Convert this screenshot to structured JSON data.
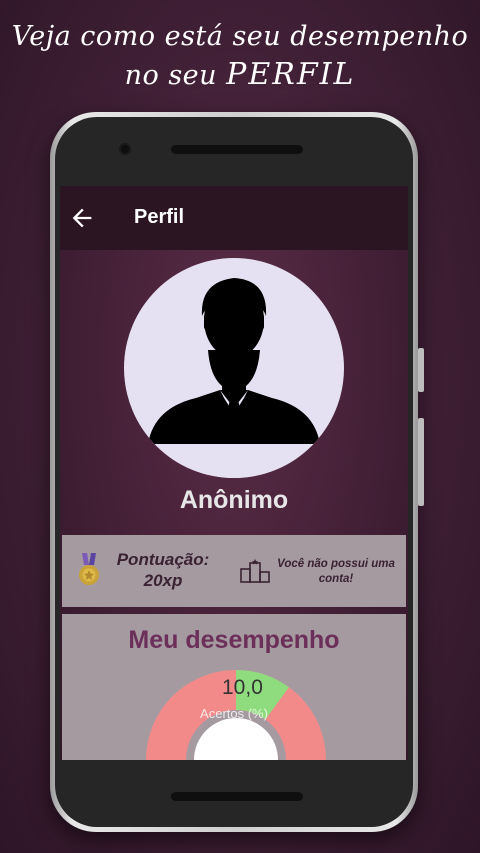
{
  "promo": {
    "line1": "Veja como está seu desempenho",
    "line2_prefix": "no seu ",
    "line2_emphasis": "PERFIL"
  },
  "appbar": {
    "title": "Perfil",
    "back_icon": "arrow-left-icon"
  },
  "profile": {
    "name": "Anônimo",
    "avatar_icon": "person-silhouette-icon"
  },
  "stats": {
    "score_label": "Pontuação:",
    "score_value": "20xp",
    "account_message": "Você não possui uma conta!",
    "medal_icon": "medal-icon",
    "podium_icon": "podium-icon"
  },
  "performance": {
    "title": "Meu desempenho",
    "value": "10,0",
    "label": "Acertos (%)",
    "hits_percent": 10,
    "colors": {
      "hits": "#8fdc7e",
      "misses": "#f28a8a"
    }
  },
  "colors": {
    "appbar": "#2b1523",
    "card": "#a69aa1",
    "title_accent": "#6b2f5a"
  }
}
